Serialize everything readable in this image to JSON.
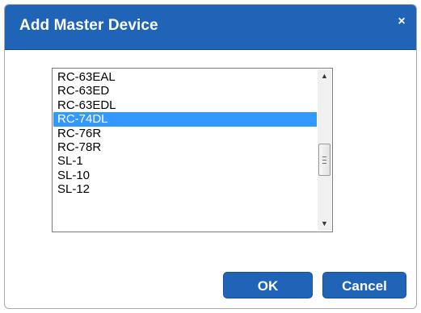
{
  "dialog": {
    "title": "Add Master Device",
    "close_glyph": "×"
  },
  "device_list": {
    "items": [
      "RC-63EAL",
      "RC-63ED",
      "RC-63EDL",
      "RC-74DL",
      "RC-76R",
      "RC-78R",
      "SL-1",
      "SL-10",
      "SL-12"
    ],
    "selected": "RC-74DL"
  },
  "scrollbar": {
    "up_glyph": "▲",
    "down_glyph": "▼",
    "up_icon": "scroll-up-icon",
    "down_icon": "scroll-down-icon"
  },
  "buttons": {
    "ok_label": "OK",
    "cancel_label": "Cancel"
  },
  "colors": {
    "accent": "#1f64b6",
    "selection": "#3399ff"
  }
}
